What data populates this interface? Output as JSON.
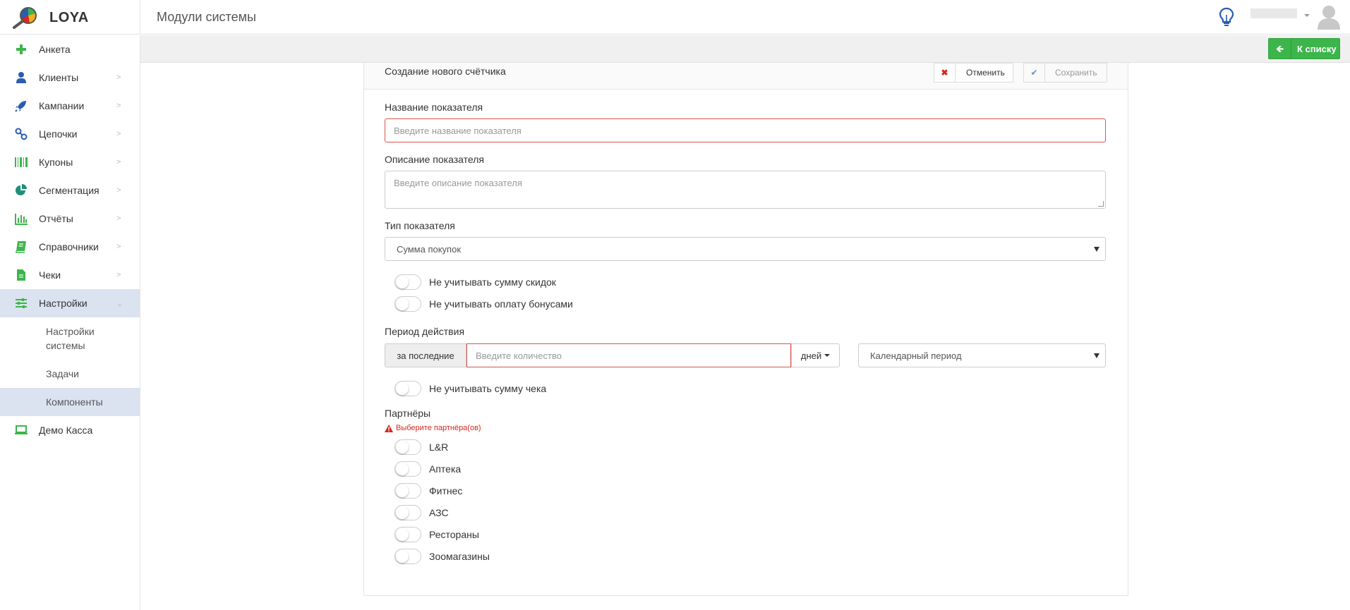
{
  "app": {
    "logo_text": "LOYA",
    "page_title": "Модули системы"
  },
  "subbar": {
    "back_label": "К списку"
  },
  "sidebar": {
    "items": [
      {
        "label": "Анкета",
        "icon": "plus-icon",
        "color": "#3cb54b"
      },
      {
        "label": "Клиенты",
        "icon": "user-icon",
        "color": "#2a5db0"
      },
      {
        "label": "Кампании",
        "icon": "rocket-icon",
        "color": "#2a5db0"
      },
      {
        "label": "Цепочки",
        "icon": "chain-icon",
        "color": "#2a5db0"
      },
      {
        "label": "Купоны",
        "icon": "barcode-icon",
        "color": "#3cb54b"
      },
      {
        "label": "Сегментация",
        "icon": "pie-chart-icon",
        "color": "#1e8f7a"
      },
      {
        "label": "Отчёты",
        "icon": "bar-chart-icon",
        "color": "#3cb54b"
      },
      {
        "label": "Справочники",
        "icon": "book-icon",
        "color": "#3cb54b"
      },
      {
        "label": "Чеки",
        "icon": "document-icon",
        "color": "#3cb54b"
      },
      {
        "label": "Настройки",
        "icon": "sliders-icon",
        "color": "#3cb54b"
      }
    ],
    "subitems": [
      {
        "label": "Настройки системы"
      },
      {
        "label": "Задачи"
      },
      {
        "label": "Компоненты"
      }
    ],
    "demo": {
      "label": "Демо Касса",
      "icon": "laptop-icon"
    }
  },
  "form": {
    "title": "Создание нового счётчика",
    "cancel_label": "Отменить",
    "save_label": "Сохранить",
    "name_label": "Название показателя",
    "name_placeholder": "Введите название показателя",
    "desc_label": "Описание показателя",
    "desc_placeholder": "Введите описание показателя",
    "type_label": "Тип показателя",
    "type_value": "Сумма покупок",
    "toggle_discounts": "Не учитывать сумму скидок",
    "toggle_bonuses": "Не учитывать оплату бонусами",
    "period_label": "Период действия",
    "period_prefix": "за последние",
    "period_placeholder": "Введите количество",
    "period_unit": "дней",
    "period_type": "Календарный период",
    "toggle_receipt": "Не учитывать сумму чека",
    "partners_label": "Партнёры",
    "partners_error": "Выберите партнёра(ов)",
    "partners": [
      "L&R",
      "Аптека",
      "Фитнес",
      "АЗС",
      "Рестораны",
      "Зоомагазины"
    ]
  }
}
